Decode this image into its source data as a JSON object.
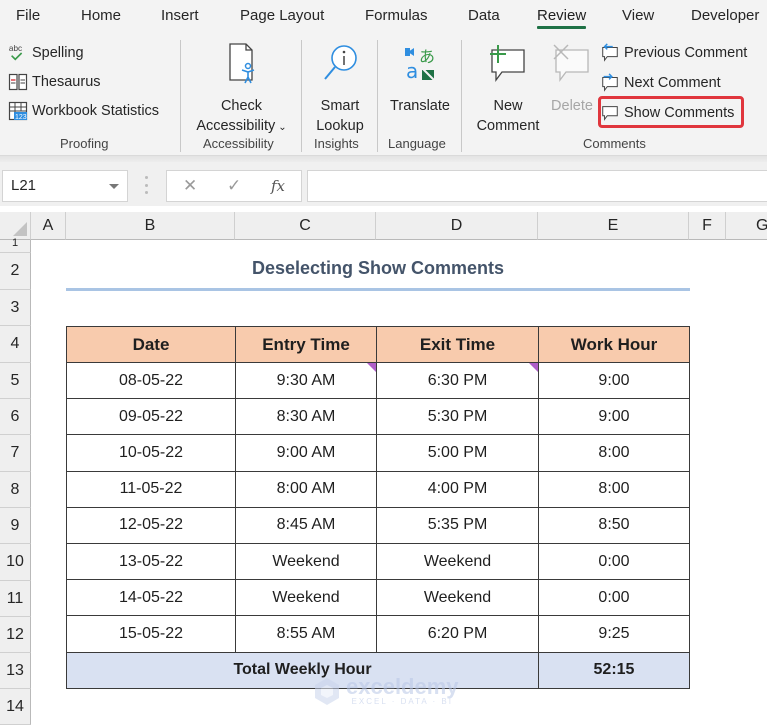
{
  "ribbon": {
    "tabs": [
      {
        "label": "File"
      },
      {
        "label": "Home"
      },
      {
        "label": "Insert"
      },
      {
        "label": "Page Layout"
      },
      {
        "label": "Formulas"
      },
      {
        "label": "Data"
      },
      {
        "label": "Review",
        "active": true
      },
      {
        "label": "View"
      },
      {
        "label": "Developer"
      }
    ],
    "groups": {
      "proofing": {
        "label": "Proofing",
        "items": [
          {
            "label": "Spelling",
            "icon": "spelling-icon"
          },
          {
            "label": "Thesaurus",
            "icon": "thesaurus-icon"
          },
          {
            "label": "Workbook Statistics",
            "icon": "workbook-statistics-icon"
          }
        ]
      },
      "accessibility": {
        "label": "Accessibility",
        "button_line1": "Check",
        "button_line2": "Accessibility",
        "icon": "check-accessibility-icon"
      },
      "insights": {
        "label": "Insights",
        "button_line1": "Smart",
        "button_line2": "Lookup",
        "icon": "smart-lookup-icon"
      },
      "language": {
        "label": "Language",
        "button_line1": "Translate",
        "icon": "translate-icon"
      },
      "comments": {
        "label": "Comments",
        "new_line1": "New",
        "new_line2": "Comment",
        "delete": "Delete",
        "previous": "Previous Comment",
        "next": "Next Comment",
        "show": "Show Comments",
        "highlight_color": "#e0363d"
      }
    }
  },
  "formula_bar": {
    "name_box": "L21",
    "cancel_icon": "✕",
    "enter_icon": "✓",
    "fx_label": "fx",
    "formula": ""
  },
  "grid": {
    "columns": [
      "A",
      "B",
      "C",
      "D",
      "E",
      "F",
      "G"
    ],
    "rows": [
      "1",
      "2",
      "3",
      "4",
      "5",
      "6",
      "7",
      "8",
      "9",
      "10",
      "11",
      "12",
      "13",
      "14"
    ]
  },
  "sheet": {
    "title": "Deselecting Show Comments",
    "headers": [
      "Date",
      "Entry Time",
      "Exit Time",
      "Work Hour"
    ],
    "rows": [
      {
        "date": "08-05-22",
        "entry": "9:30 AM",
        "exit": "6:30 PM",
        "hour": "9:00",
        "entry_comment": true,
        "exit_comment": true
      },
      {
        "date": "09-05-22",
        "entry": "8:30 AM",
        "exit": "5:30 PM",
        "hour": "9:00"
      },
      {
        "date": "10-05-22",
        "entry": "9:00 AM",
        "exit": "5:00 PM",
        "hour": "8:00"
      },
      {
        "date": "11-05-22",
        "entry": "8:00 AM",
        "exit": "4:00 PM",
        "hour": "8:00"
      },
      {
        "date": "12-05-22",
        "entry": "8:45 AM",
        "exit": "5:35 PM",
        "hour": "8:50"
      },
      {
        "date": "13-05-22",
        "entry": "Weekend",
        "exit": "Weekend",
        "hour": "0:00"
      },
      {
        "date": "14-05-22",
        "entry": "Weekend",
        "exit": "Weekend",
        "hour": "0:00"
      },
      {
        "date": "15-05-22",
        "entry": "8:55 AM",
        "exit": "6:20 PM",
        "hour": "9:25"
      }
    ],
    "total_label": "Total Weekly Hour",
    "total_value": "52:15",
    "colors": {
      "header_fill": "#f8cbad",
      "total_fill": "#d9e1f2",
      "title_color": "#44546a",
      "comment_indicator": "#b05fc9"
    }
  },
  "watermark": {
    "name": "exceldemy",
    "tagline": "EXCEL · DATA · BI"
  }
}
